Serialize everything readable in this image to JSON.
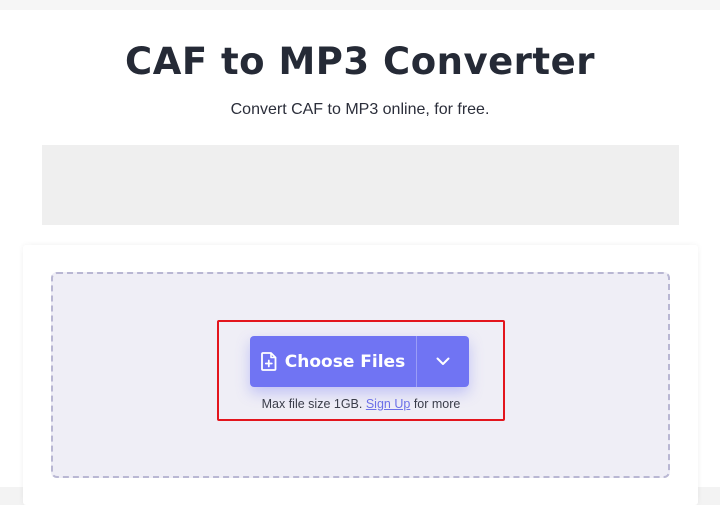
{
  "header": {
    "title": "CAF to MP3 Converter",
    "subtitle": "Convert CAF to MP3 online, for free."
  },
  "upload": {
    "choose_label": "Choose Files",
    "file_icon": "file-plus-icon",
    "dropdown_icon": "chevron-down-icon",
    "note_prefix": "Max file size 1GB.",
    "signup_label": "Sign Up",
    "note_suffix": "for more"
  },
  "colors": {
    "accent": "#7074f3",
    "highlight_border": "#e3151d",
    "dropzone_bg": "#efeef6",
    "link": "#6c70e8"
  }
}
